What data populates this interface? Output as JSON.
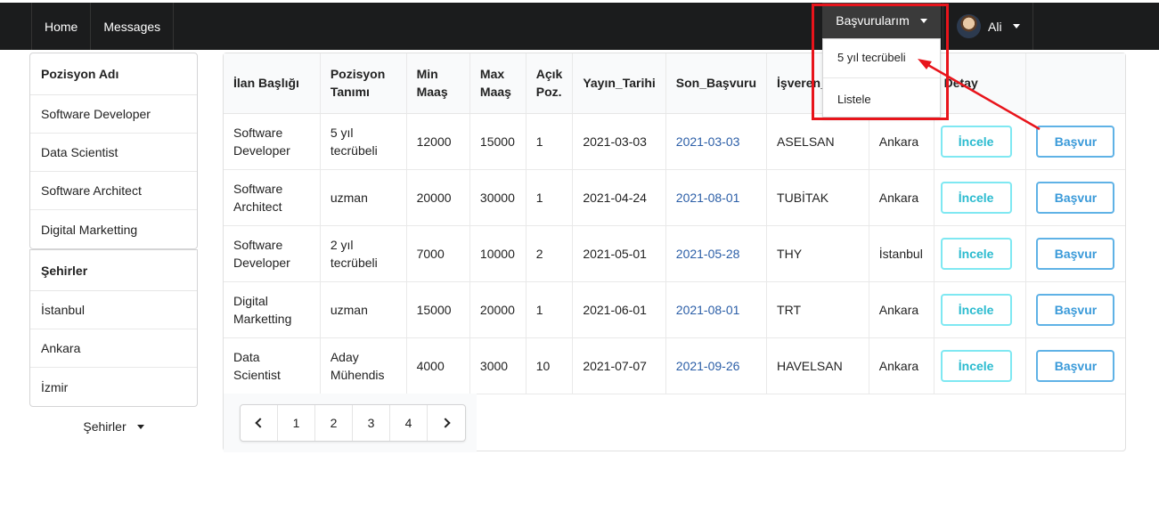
{
  "nav": {
    "home": "Home",
    "messages": "Messages",
    "applications_label": "Başvurularım",
    "user_name": "Ali"
  },
  "applications_menu": {
    "items": [
      "5 yıl tecrübeli",
      "Listele"
    ]
  },
  "sidebar": {
    "positions_header": "Pozisyon Adı",
    "positions": [
      "Software Developer",
      "Data Scientist",
      "Software Architect",
      "Digital Marketting"
    ],
    "cities_header": "Şehirler",
    "cities": [
      "İstanbul",
      "Ankara",
      "İzmir"
    ],
    "cities_dropdown": "Şehirler"
  },
  "table": {
    "headers": [
      "İlan Başlığı",
      "Pozisyon Tanımı",
      "Min Maaş",
      "Max Maaş",
      "Açık Poz.",
      "Yayın_Tarihi",
      "Son_Başvuru",
      "İşveren_K",
      "",
      "Detay",
      ""
    ],
    "rows": [
      {
        "title": "Software Developer",
        "desc": "5 yıl tecrübeli",
        "min": "12000",
        "max": "15000",
        "open": "1",
        "pub": "2021-03-03",
        "deadline": "2021-03-03",
        "employer": "ASELSAN",
        "city": "Ankara"
      },
      {
        "title": "Software Architect",
        "desc": "uzman",
        "min": "20000",
        "max": "30000",
        "open": "1",
        "pub": "2021-04-24",
        "deadline": "2021-08-01",
        "employer": "TUBİTAK",
        "city": "Ankara"
      },
      {
        "title": "Software Developer",
        "desc": "2 yıl tecrübeli",
        "min": "7000",
        "max": "10000",
        "open": "2",
        "pub": "2021-05-01",
        "deadline": "2021-05-28",
        "employer": "THY",
        "city": "İstanbul"
      },
      {
        "title": "Digital Marketting",
        "desc": "uzman",
        "min": "15000",
        "max": "20000",
        "open": "1",
        "pub": "2021-06-01",
        "deadline": "2021-08-01",
        "employer": "TRT",
        "city": "Ankara"
      },
      {
        "title": "Data Scientist",
        "desc": "Aday Mühendis",
        "min": "4000",
        "max": "3000",
        "open": "10",
        "pub": "2021-07-07",
        "deadline": "2021-09-26",
        "employer": "HAVELSAN",
        "city": "Ankara"
      }
    ],
    "detail_button": "İncele",
    "apply_button": "Başvur"
  },
  "pagination": {
    "pages": [
      "1",
      "2",
      "3",
      "4"
    ]
  },
  "colors": {
    "navbar": "#1b1c1d",
    "annotation_red": "#e8141b",
    "link": "#2b5ea7",
    "incele_border": "#7fe8f2",
    "basvur_border": "#5fb2e6"
  }
}
